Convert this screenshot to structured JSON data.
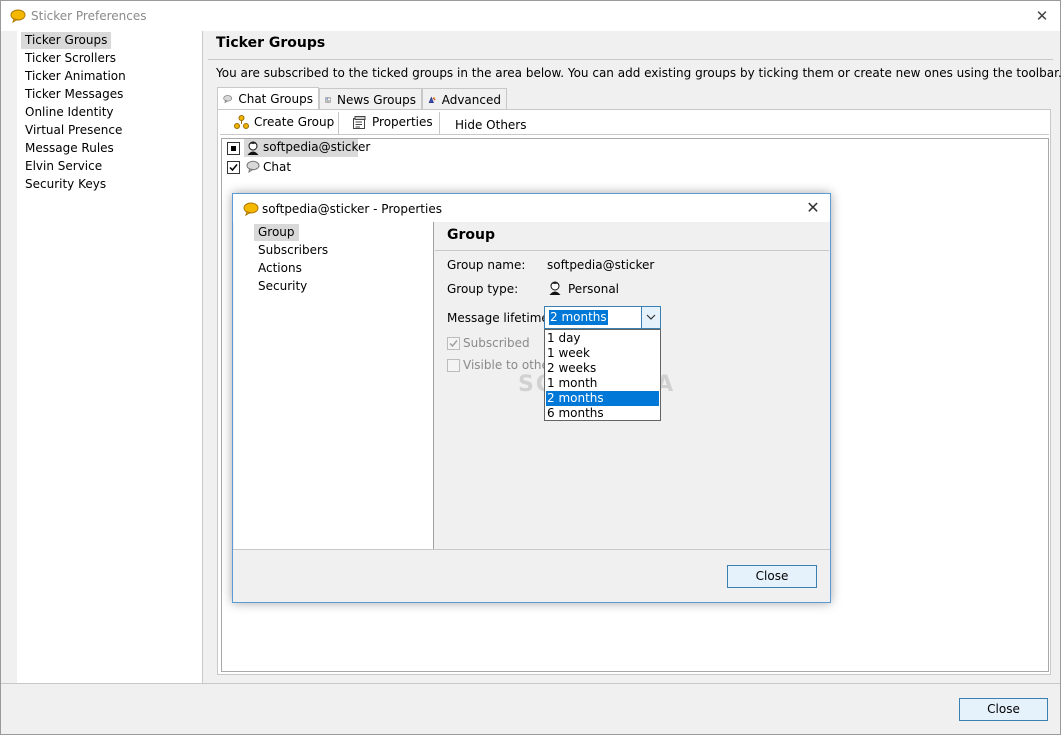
{
  "window": {
    "title": "Sticker Preferences",
    "close_glyph": "✕"
  },
  "nav": {
    "items": [
      {
        "label": "Ticker Groups"
      },
      {
        "label": "Ticker Scrollers"
      },
      {
        "label": "Ticker Animation"
      },
      {
        "label": "Ticker Messages"
      },
      {
        "label": "Online Identity"
      },
      {
        "label": "Virtual Presence"
      },
      {
        "label": "Message Rules"
      },
      {
        "label": "Elvin Service"
      },
      {
        "label": "Security Keys"
      }
    ]
  },
  "panel": {
    "title": "Ticker Groups",
    "description": "You are subscribed to the ticked groups in the area below. You can add existing groups by ticking them or create new ones using the toolbar."
  },
  "tabs": [
    {
      "label": "Chat Groups",
      "icon": "chat-bubble-icon"
    },
    {
      "label": "News Groups",
      "icon": "newspaper-icon"
    },
    {
      "label": "Advanced",
      "icon": "wizard-icon"
    }
  ],
  "toolbar": {
    "create_label": "Create Group",
    "properties_label": "Properties",
    "hide_label": "Hide Others"
  },
  "groups": [
    {
      "name": "softpedia@sticker",
      "checked": "partial",
      "icon": "person-icon"
    },
    {
      "name": "Chat",
      "checked": "checked",
      "icon": "chat-bubble-icon"
    }
  ],
  "bottom": {
    "close_label": "Close"
  },
  "dialog": {
    "title": "softpedia@sticker - Properties",
    "close_glyph": "✕",
    "nav": [
      "Group",
      "Subscribers",
      "Actions",
      "Security"
    ],
    "section_title": "Group",
    "group_name_label": "Group name:",
    "group_name_value": "softpedia@sticker",
    "group_type_label": "Group type:",
    "group_type_value": "Personal",
    "lifetime_label": "Message lifetime:",
    "lifetime_value": "2 months",
    "subscribed_label": "Subscribed",
    "visible_label": "Visible to others",
    "close_label": "Close",
    "lifetime_options": [
      "1 day",
      "1 week",
      "2 weeks",
      "1 month",
      "2 months",
      "6 months"
    ]
  },
  "colors": {
    "accent": "#0078d7",
    "button_border": "#3c7fb1",
    "button_bg": "#e5f1fb"
  },
  "watermark": "SOFTPEDIA"
}
